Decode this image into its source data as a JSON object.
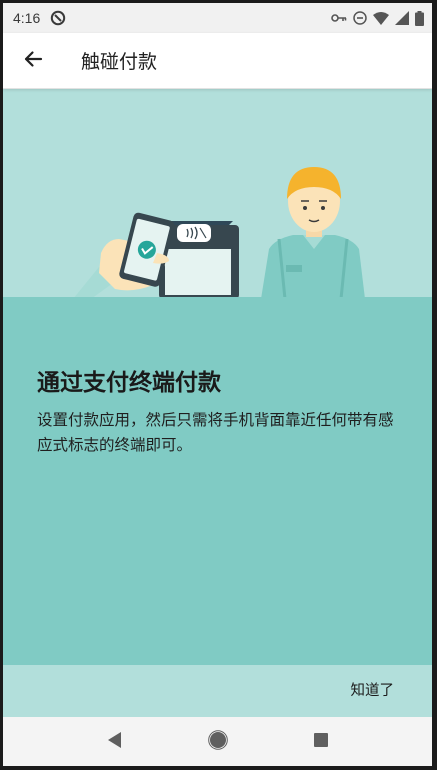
{
  "status_bar": {
    "time": "4:16",
    "left_icon": "sync-icon",
    "right_icons": [
      "vpn-key-icon",
      "do-not-disturb-icon",
      "wifi-icon",
      "signal-icon",
      "battery-icon"
    ]
  },
  "app_bar": {
    "back_icon": "arrow-back-icon",
    "title": "触碰付款"
  },
  "hero": {
    "illustration": "phone-tap-payment-terminal-illustration",
    "colors": {
      "background": "#b2dfdb",
      "counter": "#80cbc4"
    }
  },
  "content": {
    "headline": "通过支付终端付款",
    "body": "设置付款应用，然后只需将手机背面靠近任何带有感应式标志的终端即可。"
  },
  "footer": {
    "got_it_label": "知道了"
  },
  "nav_bar": {
    "icons": [
      "nav-back-icon",
      "nav-home-icon",
      "nav-recents-icon"
    ]
  }
}
